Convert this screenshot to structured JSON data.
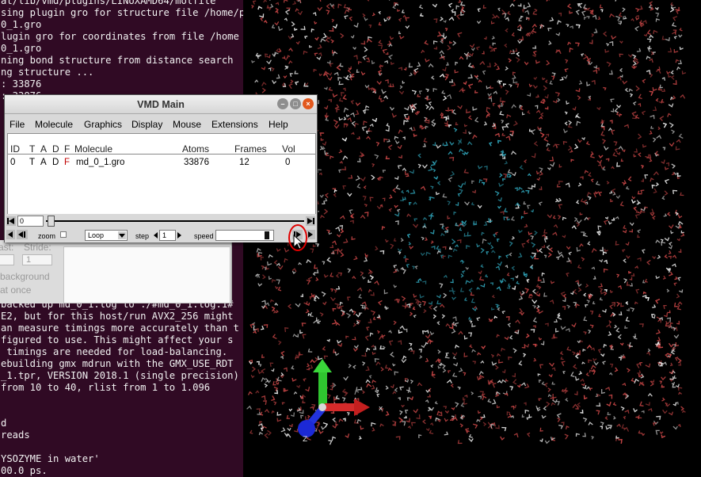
{
  "terminal": {
    "top_lines": [
      "at/lib/vmd/plugins/LINUXAMD64/molfile",
      "sing plugin gro for structure file /home/p",
      "0_1.gro",
      "lugin gro for coordinates from file /home",
      "0_1.gro",
      "ning bond structure from distance search",
      "ng structure ...",
      ": 33876",
      ": 33876"
    ],
    "bottom_lines": [
      "backed up md_0_1.log to ./#md_0_1.log.1#",
      "E2, but for this host/run AVX2_256 might",
      "an measure timings more accurately than t",
      "figured to use. This might affect your s",
      " timings are needed for load-balancing.",
      "ebuilding gmx mdrun with the GMX_USE_RDT",
      "_1.tpr, VERSION 2018.1 (single precision)",
      "from 10 to 40, rlist from 1 to 1.096",
      "",
      "",
      "d",
      "reads",
      "",
      "YSOZYME in water'",
      "00.0 ps."
    ]
  },
  "background_window": {
    "last_label": "ast:",
    "stride_label": "Stride:",
    "stride_value": "1",
    "background_label": "background",
    "at_once_label": "at once"
  },
  "vmd_main": {
    "title": "VMD Main",
    "menus": [
      "File",
      "Molecule",
      "Graphics",
      "Display",
      "Mouse",
      "Extensions",
      "Help"
    ],
    "columns": {
      "id": "ID",
      "t": "T",
      "a": "A",
      "d": "D",
      "f": "F",
      "molecule": "Molecule",
      "atoms": "Atoms",
      "frames": "Frames",
      "vol": "Vol"
    },
    "row": {
      "id": "0",
      "t": "T",
      "a": "A",
      "d": "D",
      "f": "F",
      "molecule": "md_0_1.gro",
      "atoms": "33876",
      "frames": "12",
      "vol": "0"
    },
    "frame_value": "0",
    "zoom_label": "zoom",
    "loop_value": "Loop",
    "step_label": "step",
    "step_value": "1",
    "speed_label": "speed",
    "speed_level": 0.92
  },
  "display": {
    "axes": {
      "x_label": "x",
      "z_label": "Z"
    },
    "colors": {
      "water": "#c24444",
      "hydrogen": "#e6e6e6",
      "protein": "#2fa3b8",
      "x_axis": "#d42a2a",
      "y_axis": "#2fc52f",
      "z_axis": "#2233dd",
      "highlight": "#e00000"
    }
  },
  "icons": {
    "close": "close-icon",
    "minimize": "minimize-icon",
    "maximize": "maximize-icon",
    "first_frame": "first-frame-icon",
    "last_frame": "last-frame-icon",
    "step_back": "step-back-icon",
    "play_reverse": "play-reverse-icon",
    "play_forward": "play-forward-icon",
    "step_forward": "step-forward-icon",
    "dropdown": "chevron-down-icon"
  }
}
